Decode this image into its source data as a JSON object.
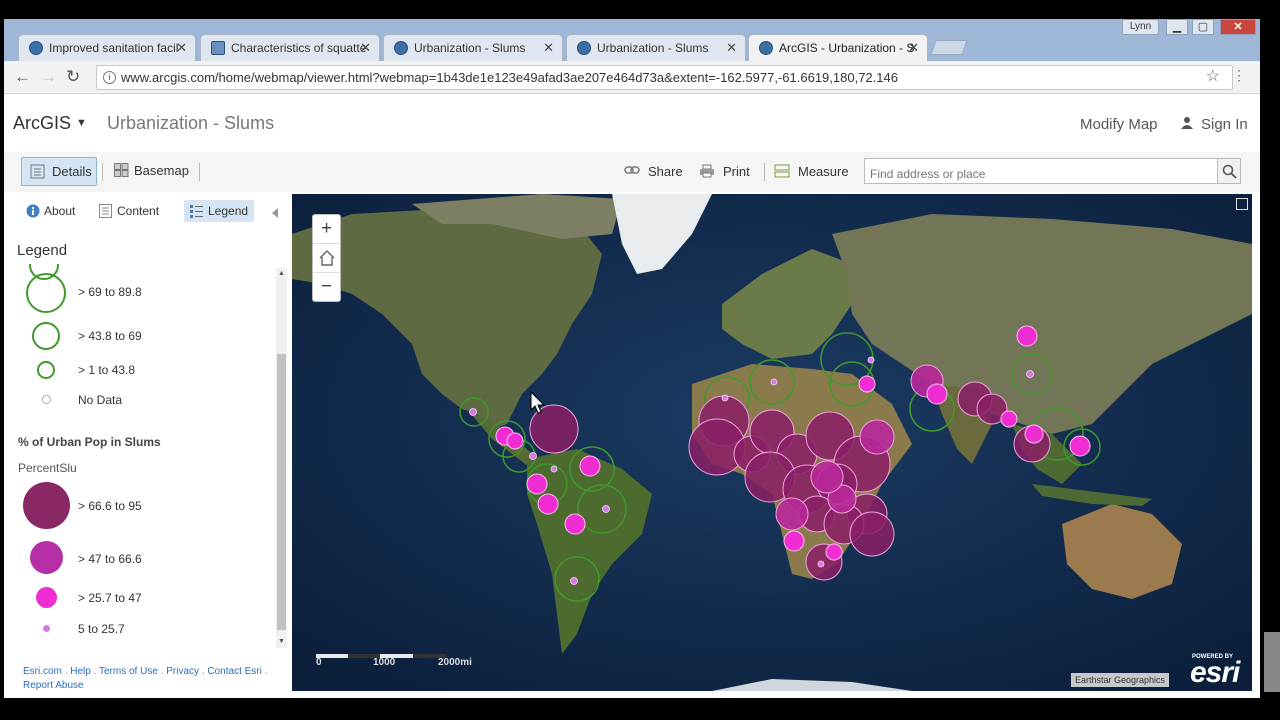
{
  "browser": {
    "tabs": [
      {
        "title": "Improved sanitation facil",
        "icon": "globe-icon"
      },
      {
        "title": "Characteristics of squatte",
        "icon": "document-icon"
      },
      {
        "title": "Urbanization - Slums",
        "icon": "globe-icon"
      },
      {
        "title": "Urbanization - Slums",
        "icon": "globe-icon"
      },
      {
        "title": "ArcGIS - Urbanization - S",
        "icon": "globe-icon"
      }
    ],
    "user": "Lynn",
    "url": "www.arcgis.com/home/webmap/viewer.html?webmap=1b43de1e123e49afad3ae207e464d73a&extent=-162.5977,-61.6619,180,72.146"
  },
  "header": {
    "brand": "ArcGIS",
    "map_title": "Urbanization - Slums",
    "modify_map": "Modify Map",
    "sign_in": "Sign In"
  },
  "toolbar": {
    "details": "Details",
    "basemap": "Basemap",
    "share": "Share",
    "print": "Print",
    "measure": "Measure",
    "search_placeholder": "Find address or place"
  },
  "panel": {
    "tabs": {
      "about": "About",
      "content": "Content",
      "legend": "Legend"
    },
    "legend_heading": "Legend",
    "layer1": {
      "items": [
        {
          "label": "> 69 to 89.8"
        },
        {
          "label": "> 43.8 to 69"
        },
        {
          "label": "> 1 to 43.8"
        },
        {
          "label": "No Data"
        }
      ]
    },
    "layer2": {
      "title": "% of Urban Pop in Slums",
      "field": "PercentSlu",
      "items": [
        {
          "label": "> 66.6 to 95"
        },
        {
          "label": "> 47 to 66.6"
        },
        {
          "label": "> 25.7 to 47"
        },
        {
          "label": "5 to 25.7"
        }
      ]
    },
    "footer": {
      "links": [
        "Esri.com",
        "Help",
        "Terms of Use",
        "Privacy",
        "Contact Esri",
        "Report Abuse"
      ]
    }
  },
  "map": {
    "scale_labels": [
      "0",
      "1000",
      "2000mi"
    ],
    "attribution": "Earthstar Geographics",
    "powered_by": "POWERED BY",
    "esri_logo": "esri",
    "colors": {
      "ocean": "#0e2747",
      "land": "#5d6b3f",
      "slum_dark": "#8a1f66",
      "slum_mid": "#b8289a",
      "slum_bright": "#f02cd3",
      "outline": "#3f9a2a"
    }
  }
}
